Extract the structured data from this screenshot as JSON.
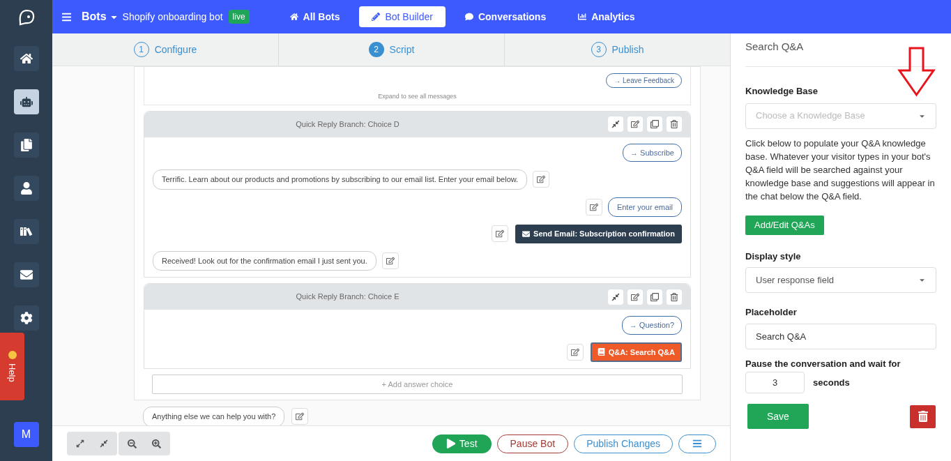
{
  "sidebar": {
    "items": [
      {
        "selected": false
      },
      {
        "selected": true
      },
      {
        "selected": false
      },
      {
        "selected": false
      },
      {
        "selected": false
      },
      {
        "selected": false
      },
      {
        "selected": false
      }
    ],
    "help": "Help",
    "avatar": "M"
  },
  "topbar": {
    "section": "Bots",
    "bot_name": "Shopify onboarding bot",
    "status": "live",
    "tabs": [
      {
        "label": "All Bots",
        "selected": false
      },
      {
        "label": "Bot Builder",
        "selected": true
      },
      {
        "label": "Conversations",
        "selected": false
      },
      {
        "label": "Analytics",
        "selected": false
      }
    ]
  },
  "steps": [
    {
      "number": "1",
      "label": "Configure",
      "selected": false
    },
    {
      "number": "2",
      "label": "Script",
      "selected": true
    },
    {
      "number": "3",
      "label": "Publish",
      "selected": false
    }
  ],
  "script": {
    "top_block": {
      "reply": "→ Leave Feedback",
      "expand": "Expand to see all messages"
    },
    "branches": [
      {
        "title": "Quick Reply Branch: Choice D",
        "messages": [
          {
            "kind": "reply",
            "text": "→ Subscribe"
          },
          {
            "kind": "bot",
            "text": "Terrific. Learn about our products and promotions by subscribing to our email list. Enter your email below."
          },
          {
            "kind": "input",
            "text": "Enter your email"
          },
          {
            "kind": "email",
            "text": "Send Email: Subscription confirmation"
          },
          {
            "kind": "bot",
            "text": "Received! Look out for the confirmation email I just sent you."
          }
        ]
      },
      {
        "title": "Quick Reply Branch: Choice E",
        "messages": [
          {
            "kind": "reply",
            "text": "→ Question?"
          },
          {
            "kind": "qa",
            "text": "Q&A: Search Q&A"
          }
        ]
      }
    ],
    "add_choice": "+ Add answer choice",
    "after": "Anything else we can help you with?"
  },
  "bottom_bar": {
    "test": "Test",
    "pause": "Pause Bot",
    "publish": "Publish Changes"
  },
  "panel": {
    "title": "Search Q&A",
    "knowledge_base": {
      "label": "Knowledge Base",
      "placeholder": "Choose a Knowledge Base"
    },
    "help_text": "Click below to populate your Q&A knowledge base. Whatever your visitor types in your bot's Q&A field will be searched against your knowledge base and suggestions will appear in the chat below the Q&A field.",
    "add_button": "Add/Edit Q&As",
    "display_style": {
      "label": "Display style",
      "value": "User response field"
    },
    "placeholder": {
      "label": "Placeholder",
      "value": "Search Q&A"
    },
    "pause": {
      "label": "Pause the conversation and wait for",
      "value": "3",
      "unit": "seconds"
    },
    "save": "Save"
  }
}
